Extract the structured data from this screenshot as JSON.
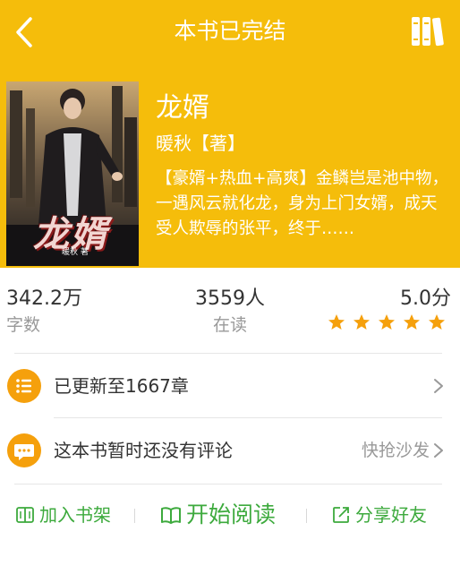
{
  "topbar": {
    "title": "本书已完结",
    "back_icon": "chevron-left-icon",
    "bookshelf_icon": "bookshelf-icon"
  },
  "book": {
    "cover_title": "龙婿",
    "cover_author": "暖秋 著",
    "name": "龙婿",
    "author": "暖秋【著】",
    "intro": "【豪婿+热血+高爽】金鳞岂是池中物，一遇风云就化龙，身为上门女婿，成天受人欺辱的张平，终于……"
  },
  "stats": {
    "word_count": "342.2万",
    "word_count_label": "字数",
    "readers": "3559人",
    "readers_label": "在读",
    "score": "5.0分",
    "stars": 5
  },
  "rows": {
    "chapters": "已更新至1667章",
    "comments": "这本书暂时还没有评论",
    "comments_action": "快抢沙发"
  },
  "actions": {
    "add_shelf": "加入书架",
    "start_reading": "开始阅读",
    "share": "分享好友"
  },
  "colors": {
    "brand": "#F5BD0B",
    "accent_orange": "#F5A00C",
    "action_green": "#3DAA3D"
  }
}
